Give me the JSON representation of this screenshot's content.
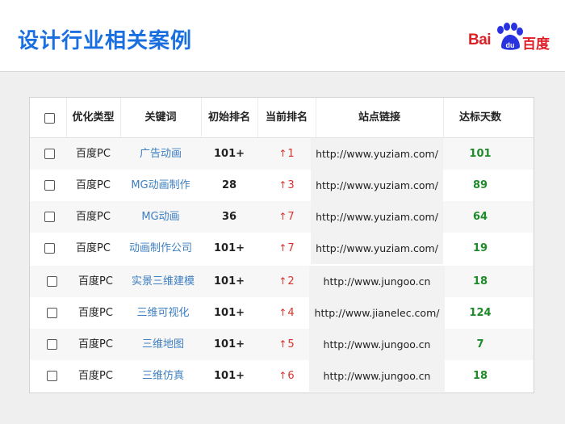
{
  "title": "设计行业相关案例",
  "logo": {
    "bai": "Bai",
    "du": "du",
    "baidu": "百度"
  },
  "table": {
    "headers": [
      "",
      "优化类型",
      "关键词",
      "初始排名",
      "当前排名",
      "站点链接",
      "达标天数"
    ],
    "rows": [
      {
        "type": "百度PC",
        "keyword": "广告动画",
        "initial": "101+",
        "current": "1",
        "url": "http://www.yuziam.com/",
        "days": "101"
      },
      {
        "type": "百度PC",
        "keyword": "MG动画制作",
        "initial": "28",
        "current": "3",
        "url": "http://www.yuziam.com/",
        "days": "89"
      },
      {
        "type": "百度PC",
        "keyword": "MG动画",
        "initial": "36",
        "current": "7",
        "url": "http://www.yuziam.com/",
        "days": "64"
      },
      {
        "type": "百度PC",
        "keyword": "动画制作公司",
        "initial": "101+",
        "current": "7",
        "url": "http://www.yuziam.com/",
        "days": "19"
      },
      {
        "type": "百度PC",
        "keyword": "实景三维建模",
        "initial": "101+",
        "current": "2",
        "url": "http://www.jungoo.cn",
        "days": "18"
      },
      {
        "type": "百度PC",
        "keyword": "三维可视化",
        "initial": "101+",
        "current": "4",
        "url": "http://www.jianelec.com/",
        "days": "124"
      },
      {
        "type": "百度PC",
        "keyword": "三维地图",
        "initial": "101+",
        "current": "5",
        "url": "http://www.jungoo.cn",
        "days": "7"
      },
      {
        "type": "百度PC",
        "keyword": "三维仿真",
        "initial": "101+",
        "current": "6",
        "url": "http://www.jungoo.cn",
        "days": "18"
      }
    ]
  },
  "colors": {
    "title": "#1a6fe0",
    "brand": "#de1f26",
    "keyword": "#3d7fc1",
    "rank_up": "#d9332e",
    "days": "#1f8a2a"
  },
  "icons": {
    "rank_change": "arrow-up-icon",
    "select": "checkbox-icon"
  }
}
